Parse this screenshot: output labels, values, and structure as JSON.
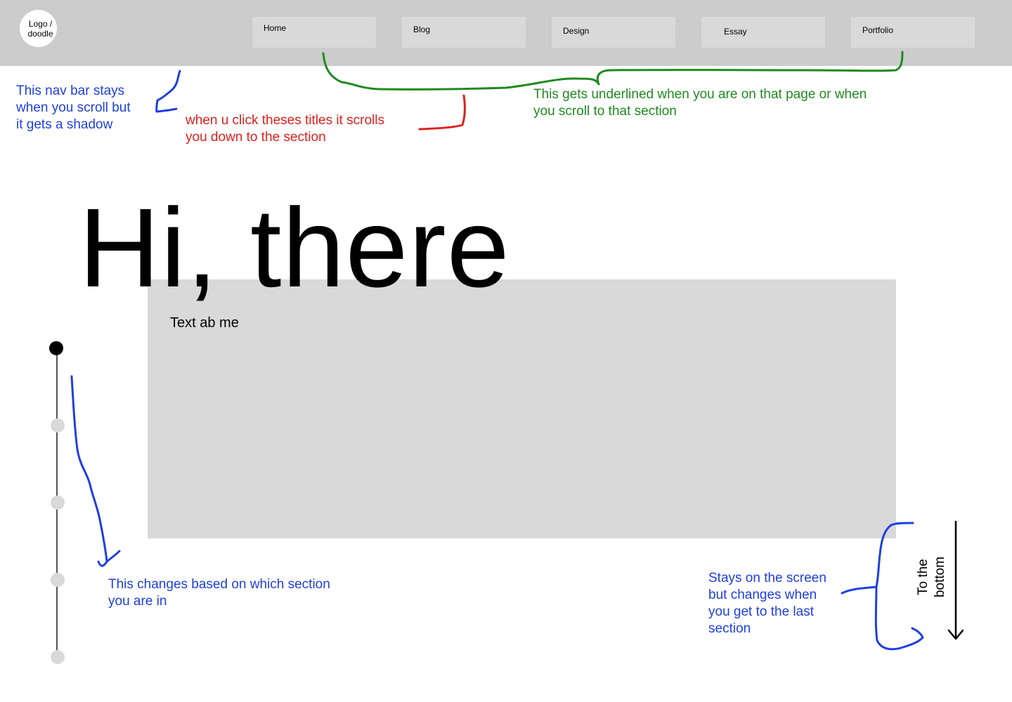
{
  "nav": {
    "logo": "Logo / doodle",
    "items": [
      {
        "label": "Home"
      },
      {
        "label": "Blog"
      },
      {
        "label": "Design"
      },
      {
        "label": "Essay"
      },
      {
        "label": "Portfolio"
      }
    ]
  },
  "annotations": {
    "navbar_note": "This nav bar stays\nwhen you scroll but\nit gets a shadow",
    "click_note": "when u click theses titles it scrolls\nyou down to the section",
    "underline_note": "This gets underlined when you are on that page or when\nyou scroll to that section",
    "timeline_note": "This changes based on which section\nyou are in",
    "scroll_note": "Stays on the screen\nbut changes when\nyou get to the last\nsection"
  },
  "hero": {
    "title": "Hi, there",
    "about_text": "Text ab me"
  },
  "scroll_button": {
    "label": "To the bottom"
  },
  "timeline": {
    "active_index": 0,
    "count": 5
  },
  "colors": {
    "navbar_bg": "#cccccc",
    "button_bg": "#d9d9d9",
    "blue_note": "#1f3fe0",
    "red_note": "#e0201f",
    "green_note": "#1f8a1f"
  }
}
